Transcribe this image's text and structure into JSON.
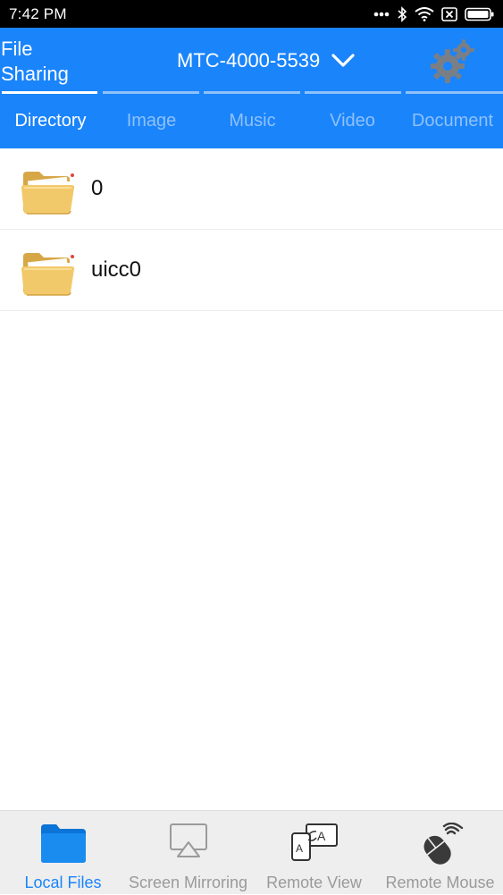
{
  "status_bar": {
    "time": "7:42 PM",
    "icons": [
      "more-dots-icon",
      "bluetooth-icon",
      "wifi-icon",
      "close-box-icon",
      "battery-icon"
    ]
  },
  "header": {
    "app_title_line1": "File",
    "app_title_line2": "Sharing",
    "device_name": "MTC-4000-5539",
    "dropdown_icon": "chevron-down-icon",
    "settings_icon": "gear-icon"
  },
  "tabs": [
    {
      "label": "Directory",
      "active": true
    },
    {
      "label": "Image",
      "active": false
    },
    {
      "label": "Music",
      "active": false
    },
    {
      "label": "Video",
      "active": false
    },
    {
      "label": "Document",
      "active": false
    }
  ],
  "files": [
    {
      "name": "0",
      "icon": "folder-icon"
    },
    {
      "name": "uicc0",
      "icon": "folder-icon"
    }
  ],
  "bottom_nav": [
    {
      "label": "Local Files",
      "icon": "folder-icon",
      "active": true
    },
    {
      "label": "Screen Mirroring",
      "icon": "airplay-icon",
      "active": false
    },
    {
      "label": "Remote View",
      "icon": "remote-view-icon",
      "active": false
    },
    {
      "label": "Remote Mouse",
      "icon": "mouse-icon",
      "active": false
    }
  ],
  "colors": {
    "accent": "#1a84fb",
    "inactive_tab": "#8fc1fb",
    "nav_inactive": "#9a9a9a",
    "status_bar": "#000000"
  }
}
